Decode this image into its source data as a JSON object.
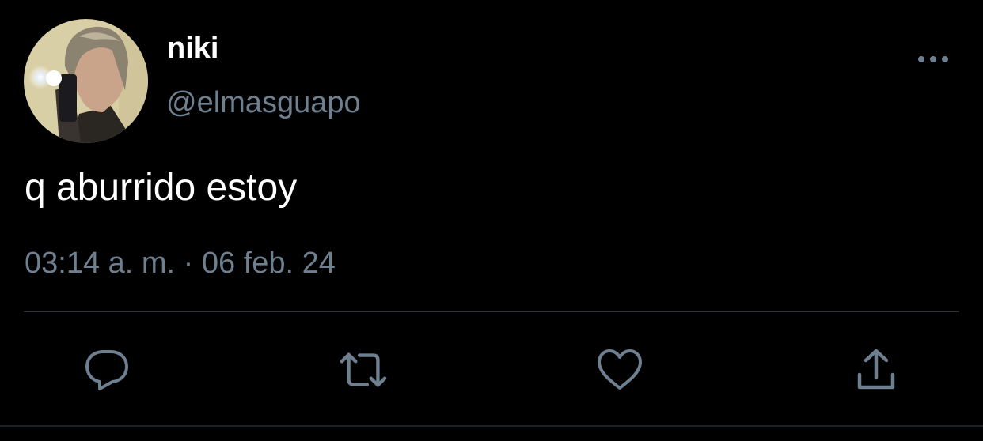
{
  "tweet": {
    "author": {
      "display_name": "niki",
      "handle": "@elmasguapo",
      "avatar_icon": "profile-photo"
    },
    "text": "q aburrido estoy",
    "meta": "03:14 a. m. · 06 feb. 24"
  },
  "actions": {
    "reply_icon": "reply-icon",
    "retweet_icon": "retweet-icon",
    "like_icon": "heart-icon",
    "share_icon": "share-icon",
    "more_icon": "more-icon"
  },
  "colors": {
    "background": "#000000",
    "primary_text": "#ffffff",
    "secondary_text": "#6e7f8f",
    "icon": "#6e7f8f",
    "divider": "#2f3336"
  }
}
